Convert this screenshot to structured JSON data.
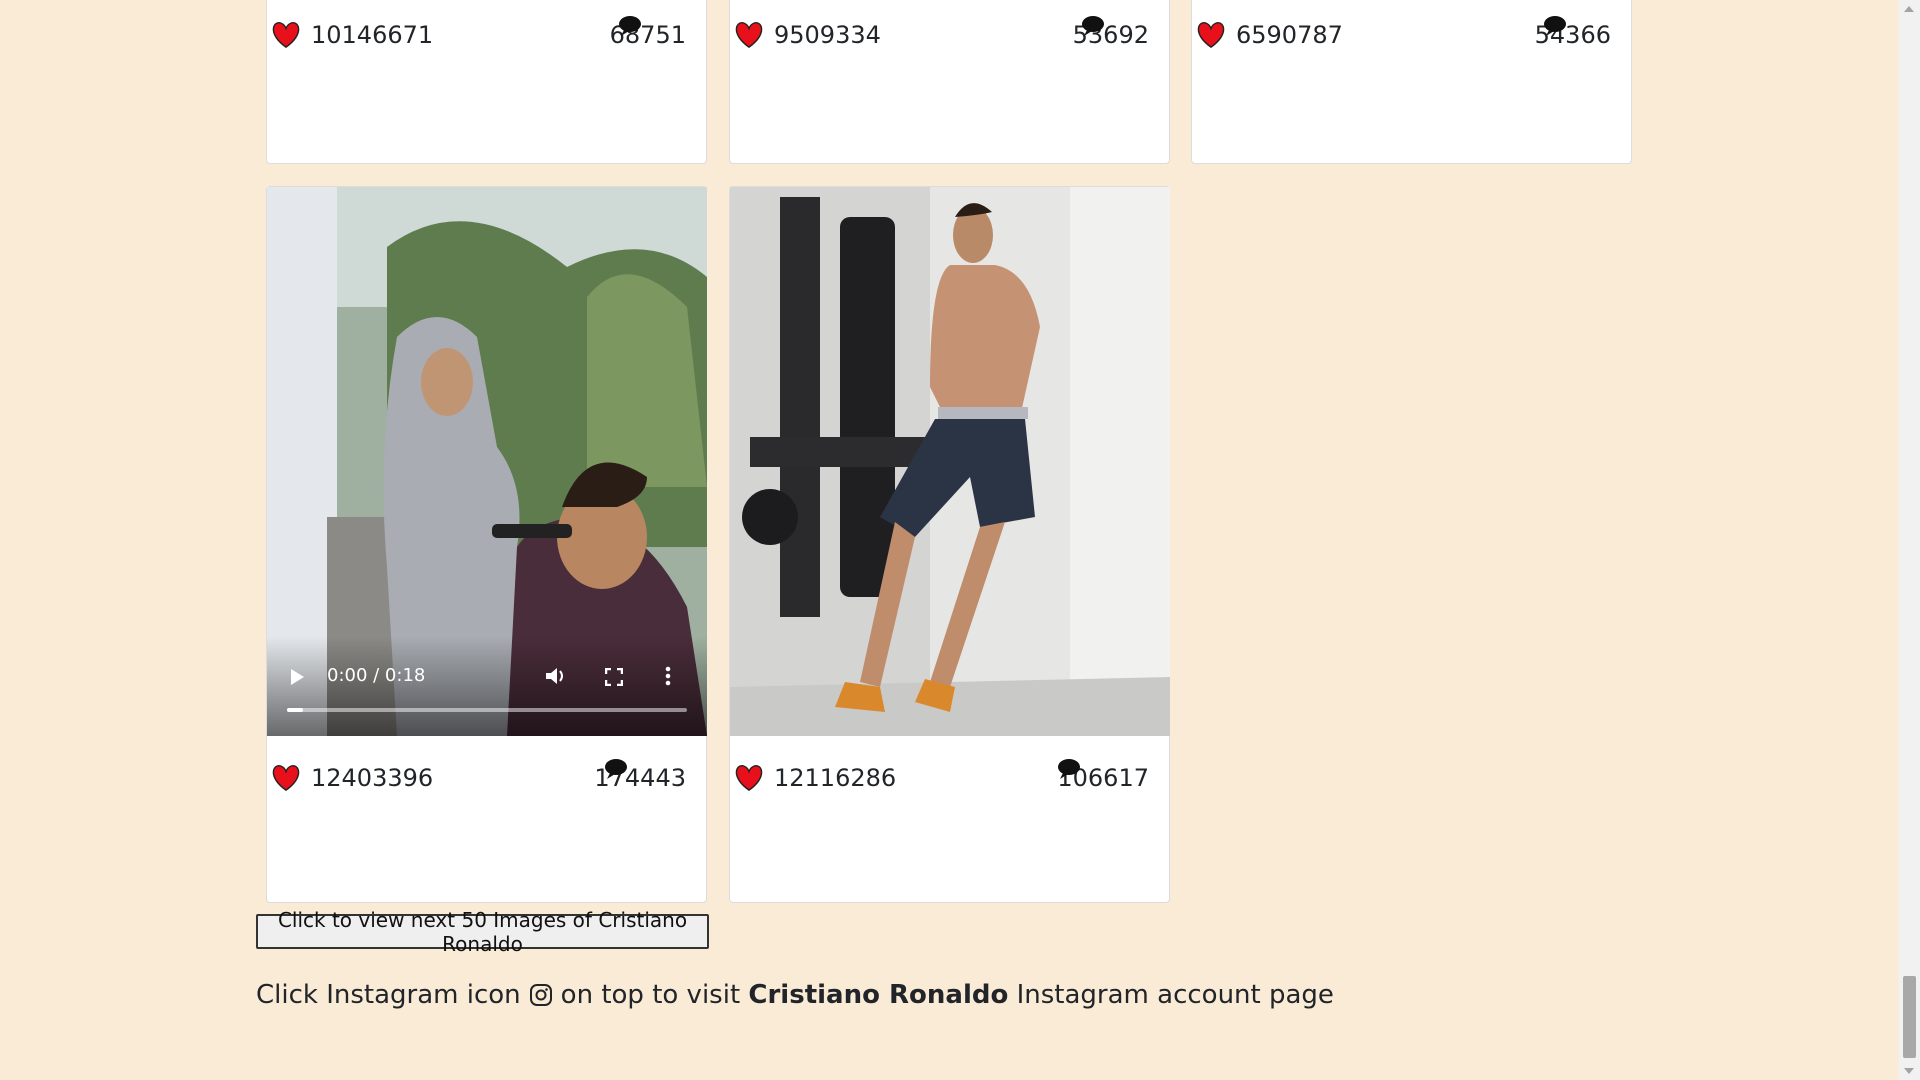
{
  "posts": [
    {
      "likes": "10146671",
      "comments": "68751",
      "type": "image"
    },
    {
      "likes": "9509334",
      "comments": "53692",
      "type": "image"
    },
    {
      "likes": "6590787",
      "comments": "54366",
      "type": "image"
    },
    {
      "likes": "12403396",
      "comments": "174443",
      "type": "video",
      "video": {
        "time": "0:00 / 0:18",
        "progress": 0.04
      }
    },
    {
      "likes": "12116286",
      "comments": "106617",
      "type": "image"
    }
  ],
  "next_button_label": "Click to view next 50 Images of Cristiano Ronaldo",
  "footer": {
    "prefix": "Click Instagram icon",
    "middle": "on top to visit",
    "name": "Cristiano Ronaldo",
    "suffix": "Instagram account page"
  },
  "colors": {
    "page_bg": "#faebd7",
    "heart": "#e8101a",
    "card_bg": "#ffffff"
  }
}
